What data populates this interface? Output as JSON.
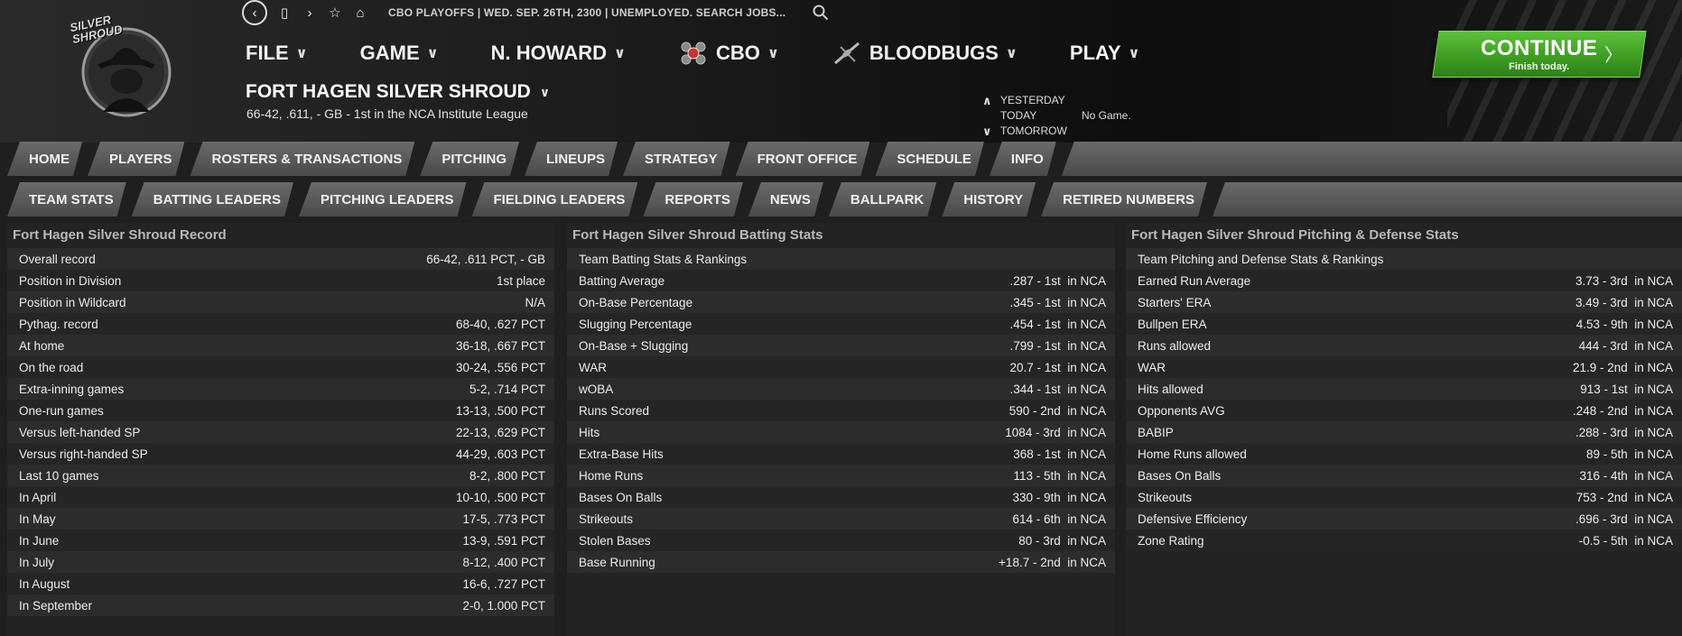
{
  "topbar": {
    "info": "CBO PLAYOFFS  |  WED. SEP. 26TH, 2300  |  UNEMPLOYED. SEARCH JOBS..."
  },
  "logo": {
    "text": "SILVER SHROUD"
  },
  "menu": [
    {
      "label": "FILE"
    },
    {
      "label": "GAME"
    },
    {
      "label": "N. HOWARD"
    },
    {
      "label": "CBO"
    },
    {
      "label": "BLOODBUGS"
    },
    {
      "label": "PLAY"
    }
  ],
  "team": {
    "title": "FORT HAGEN SILVER SHROUD",
    "subtitle": "66-42, .611, - GB - 1st in the NCA Institute League"
  },
  "daynav": {
    "yesterday": "YESTERDAY",
    "today": "TODAY",
    "tomorrow": "TOMORROW",
    "today_value": "No Game."
  },
  "continue": {
    "title": "CONTINUE",
    "subtitle": "Finish today."
  },
  "tabs_primary": [
    "HOME",
    "PLAYERS",
    "ROSTERS & TRANSACTIONS",
    "PITCHING",
    "LINEUPS",
    "STRATEGY",
    "FRONT OFFICE",
    "SCHEDULE",
    "INFO"
  ],
  "tabs_secondary": [
    "TEAM STATS",
    "BATTING LEADERS",
    "PITCHING LEADERS",
    "FIELDING LEADERS",
    "REPORTS",
    "NEWS",
    "BALLPARK",
    "HISTORY",
    "RETIRED NUMBERS"
  ],
  "record": {
    "title": "Fort Hagen Silver Shroud Record",
    "rows": [
      [
        "Overall record",
        "66-42, .611 PCT, - GB"
      ],
      [
        "Position in Division",
        "1st place"
      ],
      [
        "Position in Wildcard",
        "N/A"
      ],
      [
        "Pythag. record",
        "68-40, .627 PCT"
      ],
      [
        "At home",
        "36-18, .667 PCT"
      ],
      [
        "On the road",
        "30-24, .556 PCT"
      ],
      [
        "Extra-inning games",
        "5-2, .714 PCT"
      ],
      [
        "One-run games",
        "13-13, .500 PCT"
      ],
      [
        "Versus left-handed SP",
        "22-13, .629 PCT"
      ],
      [
        "Versus right-handed SP",
        "44-29, .603 PCT"
      ],
      [
        "Last 10 games",
        "8-2, .800 PCT"
      ],
      [
        "In April",
        "10-10, .500 PCT"
      ],
      [
        "In May",
        "17-5, .773 PCT"
      ],
      [
        "In June",
        "13-9, .591 PCT"
      ],
      [
        "In July",
        "8-12, .400 PCT"
      ],
      [
        "In August",
        "16-6, .727 PCT"
      ],
      [
        "In September",
        "2-0, 1.000 PCT"
      ]
    ]
  },
  "batting": {
    "title": "Fort Hagen Silver Shroud Batting Stats",
    "header": "Team Batting Stats & Rankings",
    "rows": [
      [
        "Batting Average",
        ".287 - 1st  in NCA"
      ],
      [
        "On-Base Percentage",
        ".345 - 1st  in NCA"
      ],
      [
        "Slugging Percentage",
        ".454 - 1st  in NCA"
      ],
      [
        "On-Base + Slugging",
        ".799 - 1st  in NCA"
      ],
      [
        "WAR",
        "20.7 - 1st  in NCA"
      ],
      [
        "wOBA",
        ".344 - 1st  in NCA"
      ],
      [
        "Runs Scored",
        "590 - 2nd  in NCA"
      ],
      [
        "Hits",
        "1084 - 3rd  in NCA"
      ],
      [
        "Extra-Base Hits",
        "368 - 1st  in NCA"
      ],
      [
        "Home Runs",
        "113 - 5th  in NCA"
      ],
      [
        "Bases On Balls",
        "330 - 9th  in NCA"
      ],
      [
        "Strikeouts",
        "614 - 6th  in NCA"
      ],
      [
        "Stolen Bases",
        "80 - 3rd  in NCA"
      ],
      [
        "Base Running",
        "+18.7 - 2nd  in NCA"
      ]
    ]
  },
  "pitching": {
    "title": "Fort Hagen Silver Shroud Pitching & Defense Stats",
    "header": "Team Pitching and Defense Stats & Rankings",
    "rows": [
      [
        "Earned Run Average",
        "3.73 - 3rd  in NCA"
      ],
      [
        "Starters' ERA",
        "3.49 - 3rd  in NCA"
      ],
      [
        "Bullpen ERA",
        "4.53 - 9th  in NCA"
      ],
      [
        "Runs allowed",
        "444 - 3rd  in NCA"
      ],
      [
        "WAR",
        "21.9 - 2nd  in NCA"
      ],
      [
        "Hits allowed",
        "913 - 1st  in NCA"
      ],
      [
        "Opponents AVG",
        ".248 - 2nd  in NCA"
      ],
      [
        "BABIP",
        ".288 - 3rd  in NCA"
      ],
      [
        "Home Runs allowed",
        "89 - 5th  in NCA"
      ],
      [
        "Bases On Balls",
        "316 - 4th  in NCA"
      ],
      [
        "Strikeouts",
        "753 - 2nd  in NCA"
      ],
      [
        "Defensive Efficiency",
        ".696 - 3rd  in NCA"
      ],
      [
        "Zone Rating",
        "-0.5 - 5th  in NCA"
      ]
    ]
  }
}
